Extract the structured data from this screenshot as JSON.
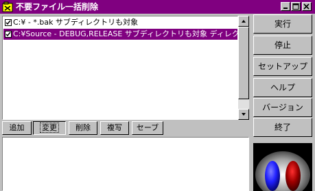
{
  "window": {
    "title": "不要ファイル一括削除"
  },
  "list": {
    "items": [
      {
        "checked": true,
        "text": "C:¥ - *.bak  サブディレクトリも対象",
        "selected": false
      },
      {
        "checked": true,
        "text": "C:¥Source - DEBUG,RELEASE  サブディレクトリも対象  ディレクトリ削除",
        "selected": true
      }
    ]
  },
  "list_buttons": {
    "add": "追加",
    "change": "変更",
    "delete": "削除",
    "copy": "複写",
    "save": "セーブ"
  },
  "side_buttons": {
    "run": "実行",
    "stop": "停止",
    "setup": "セットアップ",
    "help": "ヘルプ",
    "version": "バージョン",
    "exit": "終了"
  },
  "colors": {
    "title_bar": "#800080",
    "selection": "#800080"
  }
}
